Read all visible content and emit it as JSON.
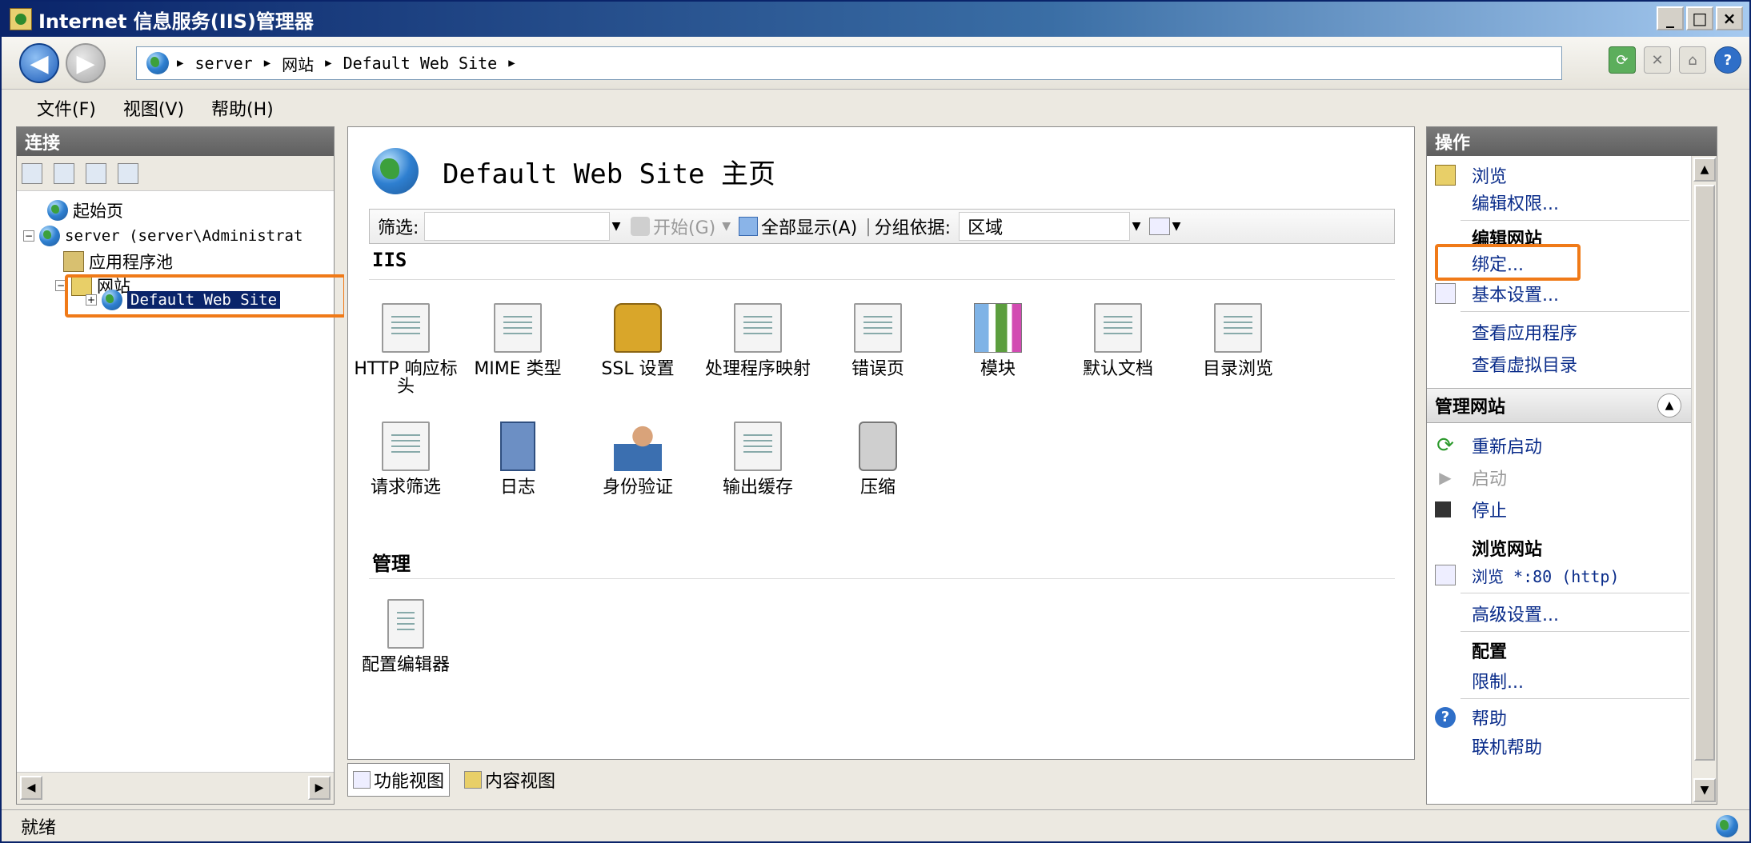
{
  "window": {
    "title": "Internet 信息服务(IIS)管理器"
  },
  "titlebar_buttons": {
    "minimize": "_",
    "maximize": "□",
    "close": "×"
  },
  "nav": {
    "breadcrumb": [
      "server",
      "网站",
      "Default Web Site"
    ],
    "help_glyph": "?"
  },
  "menu": [
    "文件(F)",
    "视图(V)",
    "帮助(H)"
  ],
  "connections": {
    "header": "连接",
    "tree": {
      "start_page": "起始页",
      "server": "server (server\\Administrat",
      "app_pools": "应用程序池",
      "sites": "网站",
      "default_site": "Default Web Site"
    }
  },
  "center": {
    "page_title": "Default Web Site 主页",
    "filter": {
      "label": "筛选:",
      "go": "开始(G)",
      "show_all": "全部显示(A)",
      "group_by_label": "分组依据:",
      "group_by_value": "区域"
    },
    "sections": {
      "iis": "IIS",
      "manage": "管理"
    },
    "iis_features": [
      "HTTP 响应标头",
      "MIME 类型",
      "SSL 设置",
      "处理程序映射",
      "错误页",
      "模块",
      "默认文档",
      "目录浏览",
      "请求筛选",
      "日志",
      "身份验证",
      "输出缓存",
      "压缩"
    ],
    "manage_features": [
      "配置编辑器"
    ],
    "tabs": {
      "features_view": "功能视图",
      "content_view": "内容视图"
    }
  },
  "actions": {
    "header": "操作",
    "browse": "浏览",
    "edit_permissions": "编辑权限...",
    "edit_site_header": "编辑网站",
    "bindings": "绑定...",
    "basic_settings": "基本设置...",
    "view_applications": "查看应用程序",
    "view_virtual_dirs": "查看虚拟目录",
    "manage_site_header": "管理网站",
    "restart": "重新启动",
    "start": "启动",
    "stop": "停止",
    "browse_site_header": "浏览网站",
    "browse_80": "浏览 *:80 (http)",
    "advanced_settings": "高级设置...",
    "config_header": "配置",
    "limits": "限制...",
    "help": "帮助",
    "online_help": "联机帮助"
  },
  "status": {
    "text": "就绪"
  },
  "colors": {
    "highlight_box": "#f07a18",
    "selection": "#0a246a"
  }
}
